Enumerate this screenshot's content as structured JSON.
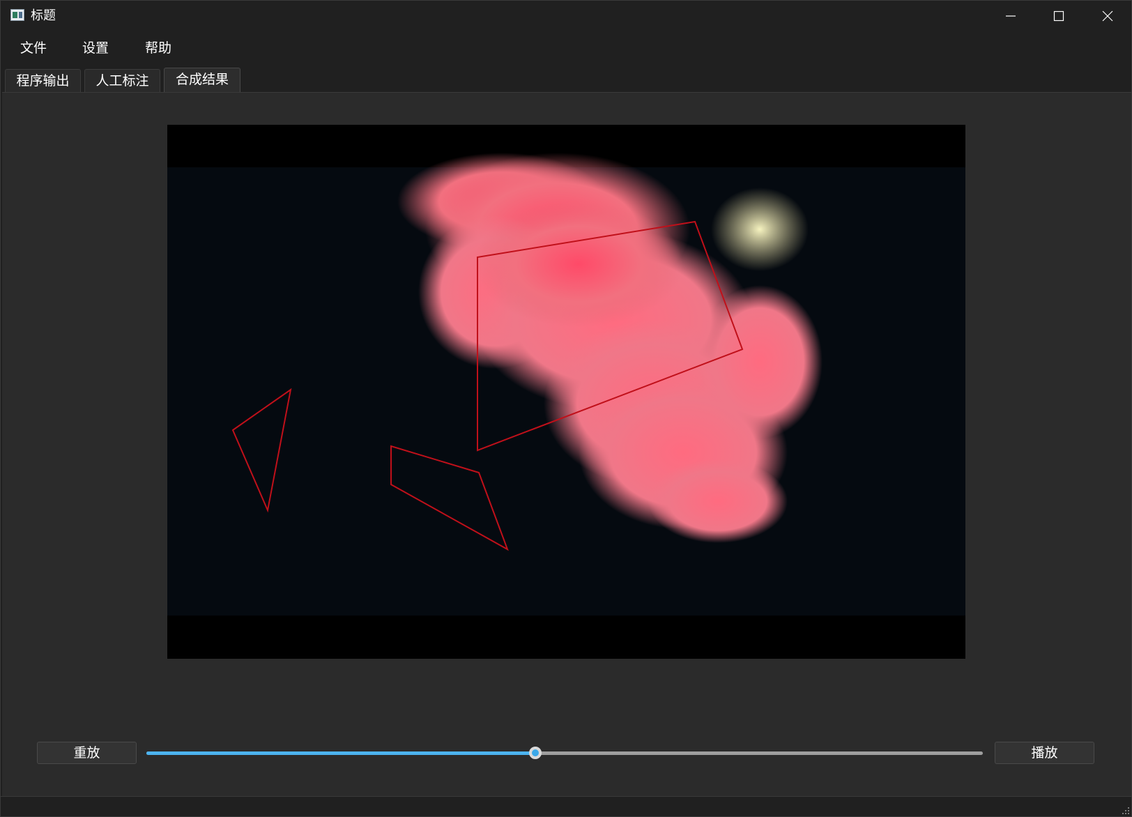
{
  "window": {
    "title": "标题"
  },
  "menu": {
    "file": "文件",
    "settings": "设置",
    "help": "帮助"
  },
  "tabs": [
    {
      "label": "程序输出",
      "active": false
    },
    {
      "label": "人工标注",
      "active": false
    },
    {
      "label": "合成结果",
      "active": true
    }
  ],
  "player": {
    "replay_label": "重放",
    "play_label": "播放",
    "progress_fraction": 0.465,
    "accent_color": "#4cb3f0",
    "annotation_color": "#c0101a",
    "frame_content": "pink ink cloud in water"
  }
}
